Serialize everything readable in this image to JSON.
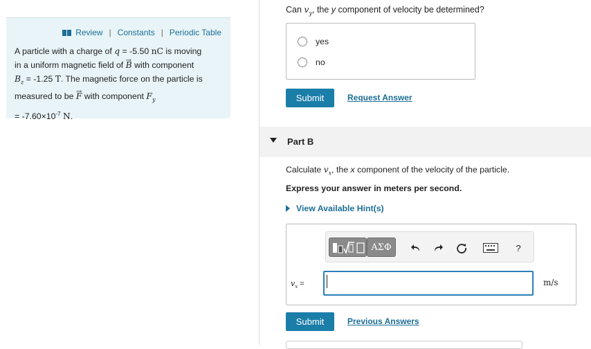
{
  "panel": {
    "links": [
      "Review",
      "Constants",
      "Periodic Table"
    ],
    "problem": {
      "l1_pre": "A particle with a charge of ",
      "l1_q": "q",
      "l1_eq": " = -5.50 ",
      "l1_unit": "nC",
      "l1_post": " is moving",
      "l2_pre": "in a uniform magnetic field of ",
      "l2_B": "B",
      "l2_post": " with component",
      "l3_B": "B",
      "l3_sub": "z",
      "l3_eq": " = -1.25 ",
      "l3_unit": "T",
      "l3_post": ". The magnetic force on the particle is",
      "l4_pre": "measured to be ",
      "l4_F": "F",
      "l4_mid": " with component ",
      "l4_F2": "F",
      "l4_sub": "y",
      "l5_pre": "= -7.60×10",
      "l5_exp": "-7",
      "l5_unit": "N",
      "l5_post": "."
    }
  },
  "part_a": {
    "q_pre": "Can ",
    "q_var": "v",
    "q_sub": "y",
    "q_mid": ", the ",
    "q_y": "y",
    "q_post": " component of velocity be determined?",
    "choices": [
      "yes",
      "no"
    ],
    "submit_label": "Submit",
    "request_label": "Request Answer"
  },
  "part_b": {
    "title": "Part B",
    "calc_pre": "Calculate ",
    "calc_var": "v",
    "calc_sub": "x",
    "calc_mid": ", the ",
    "calc_x": "x",
    "calc_post": " component of the velocity of the particle.",
    "express": "Express your answer in meters per second.",
    "hint_label": "View Available Hint(s)",
    "greek_label": "ΑΣΦ",
    "help_label": "?",
    "var_label": "v",
    "var_sub": "x",
    "var_eq": " =",
    "answer_value": "",
    "unit": "m/s",
    "submit_label": "Submit",
    "previous_label": "Previous Answers"
  },
  "colors": {
    "accent": "#1a7ea8",
    "link": "#1d6e96",
    "panel_bg": "#e8f4f7",
    "input_border": "#2a80b9"
  }
}
